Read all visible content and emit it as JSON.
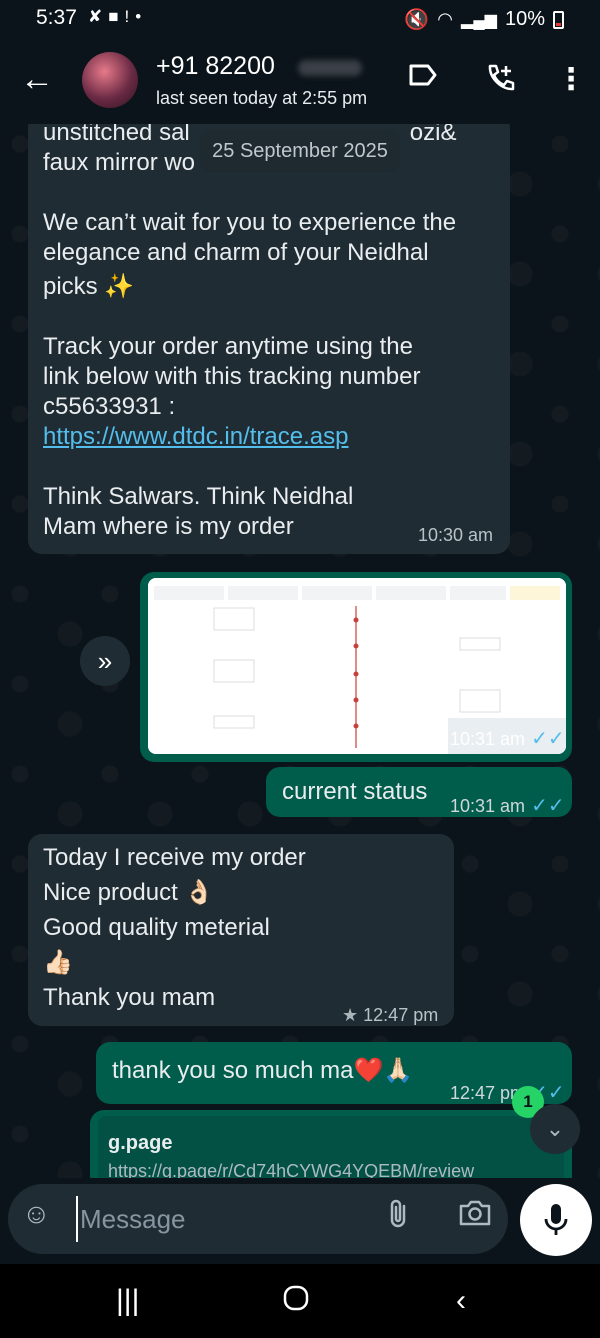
{
  "status_bar": {
    "time": "5:37",
    "battery": "10%",
    "icons": [
      "missed-call-icon",
      "folder-icon",
      "alert-icon",
      "dot-icon",
      "mute-icon",
      "wifi-icon",
      "volte-icon",
      "signal-icon",
      "battery-icon"
    ]
  },
  "header": {
    "contact_name": "+91 82200",
    "last_seen": "last seen today at 2:55 pm"
  },
  "date_pill": "25 September 2025",
  "messages": {
    "m1": {
      "line1": "unstitched sal",
      "line1b": "ozi&",
      "line2": "faux mirror wo",
      "para2": [
        "We can’t wait for you to experience the",
        "elegance and charm of your Neidhal",
        "picks ✨"
      ],
      "para3": [
        "Track your order anytime using the",
        "link below with this tracking number",
        "c55633931 :"
      ],
      "link": "https://www.dtdc.in/trace.asp",
      "para4": [
        "Think Salwars. Think Neidhal",
        "Mam where is my order"
      ],
      "time": "10:30 am"
    },
    "m2_image": {
      "time": "10:31 am"
    },
    "m3": {
      "text": "current status",
      "time": "10:31 am"
    },
    "m4": {
      "lines": [
        "Today I receive my order",
        "Nice product 👌🏻",
        "Good quality meterial",
        "👍🏻",
        "Thank you mam"
      ],
      "time": "12:47 pm",
      "starred": true
    },
    "m5": {
      "text": "thank you so much ma❤️🙏🏻",
      "time": "12:47 pm"
    },
    "m6_link": {
      "title": "g.page",
      "url": "https://g.page/r/Cd74hCYWG4YQEBM/review"
    }
  },
  "unread_count": "1",
  "composer": {
    "placeholder": "Message"
  },
  "colors": {
    "incoming": "#202c33",
    "outgoing": "#005c4b",
    "link": "#53bdeb",
    "read_ticks": "#53bdeb",
    "badge": "#25d366"
  }
}
